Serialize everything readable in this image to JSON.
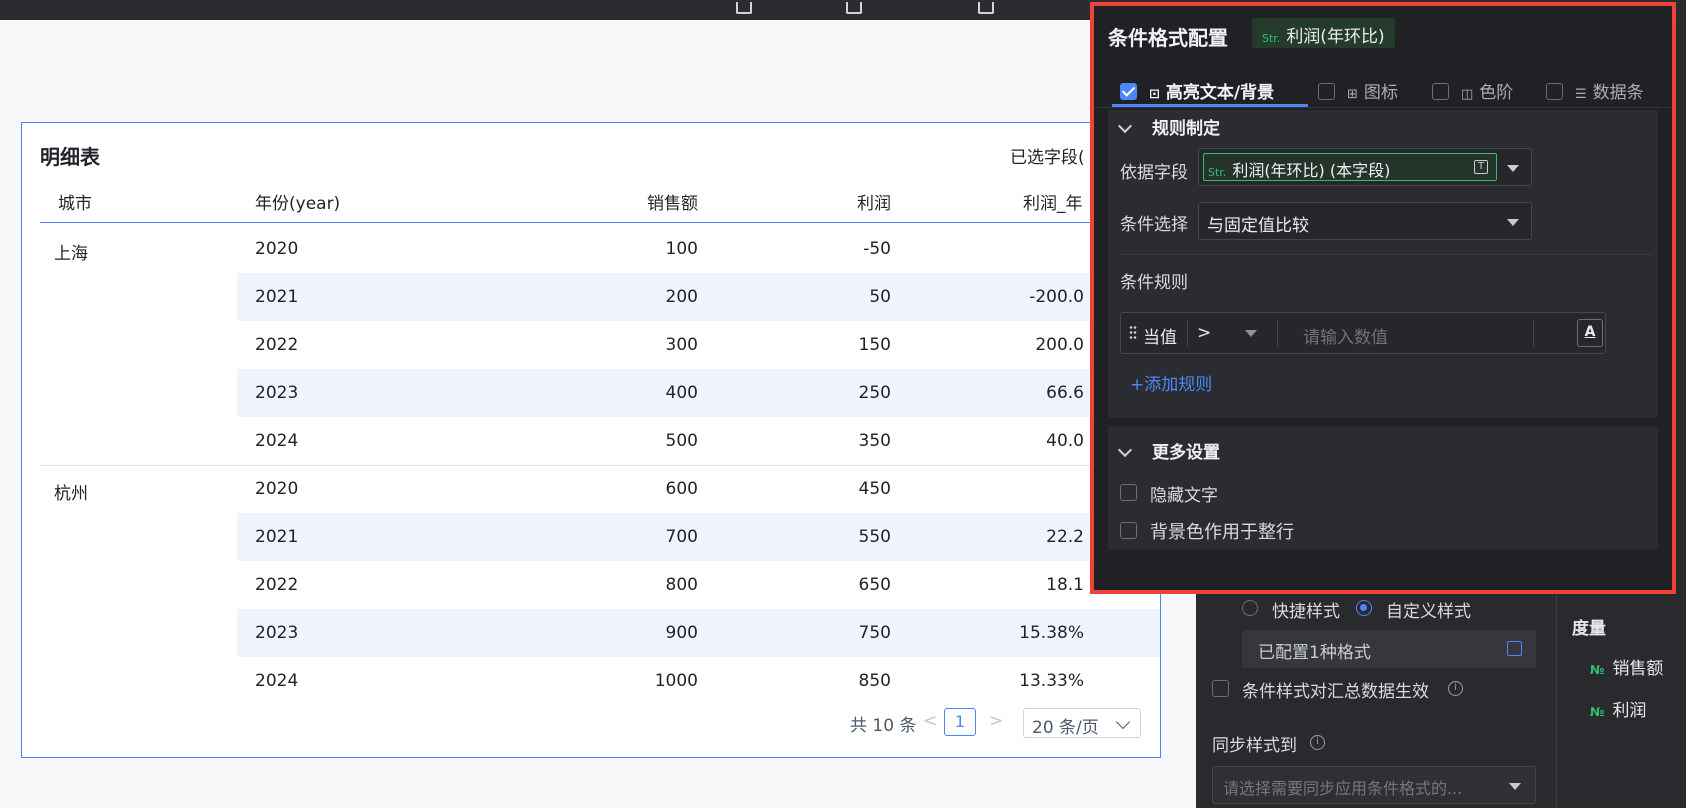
{
  "table": {
    "title": "明细表",
    "selected_fields": "已选字段(",
    "headers": [
      "城市",
      "年份(year)",
      "销售额",
      "利润",
      "利润_年"
    ],
    "groups": [
      {
        "city": "上海",
        "rows": [
          {
            "year": "2020",
            "sales": "100",
            "profit": "-50",
            "yoy": ""
          },
          {
            "year": "2021",
            "sales": "200",
            "profit": "50",
            "yoy": "-200.0"
          },
          {
            "year": "2022",
            "sales": "300",
            "profit": "150",
            "yoy": "200.0"
          },
          {
            "year": "2023",
            "sales": "400",
            "profit": "250",
            "yoy": "66.6"
          },
          {
            "year": "2024",
            "sales": "500",
            "profit": "350",
            "yoy": "40.0"
          }
        ]
      },
      {
        "city": "杭州",
        "rows": [
          {
            "year": "2020",
            "sales": "600",
            "profit": "450",
            "yoy": ""
          },
          {
            "year": "2021",
            "sales": "700",
            "profit": "550",
            "yoy": "22.2"
          },
          {
            "year": "2022",
            "sales": "800",
            "profit": "650",
            "yoy": "18.1"
          },
          {
            "year": "2023",
            "sales": "900",
            "profit": "750",
            "yoy": "15.38%"
          },
          {
            "year": "2024",
            "sales": "1000",
            "profit": "850",
            "yoy": "13.33%"
          }
        ]
      }
    ],
    "pagination": {
      "total": "共 10 条",
      "prev": "<",
      "page": "1",
      "next": ">",
      "page_size": "20 条/页"
    }
  },
  "side_panel": {
    "quick_style": "快捷样式",
    "custom_style": "自定义样式",
    "configured": "已配置1种格式",
    "apply_summary": "条件样式对汇总数据生效",
    "sync_to": "同步样式到",
    "sync_placeholder": "请选择需要同步应用条件格式的...",
    "measure_title": "度量",
    "measures": [
      {
        "type": "№",
        "label": "销售额"
      },
      {
        "type": "№",
        "label": "利润"
      }
    ]
  },
  "popup": {
    "title": "条件格式配置",
    "field_tag_type": "Str.",
    "field_tag": "利润(年环比)",
    "tabs": [
      {
        "label": "高亮文本/背景",
        "checked": true,
        "icon": "text-box-icon"
      },
      {
        "label": "图标",
        "checked": false,
        "icon": "grid-icon"
      },
      {
        "label": "色阶",
        "checked": false,
        "icon": "color-scale-icon"
      },
      {
        "label": "数据条",
        "checked": false,
        "icon": "data-bar-icon"
      }
    ],
    "rule_section": {
      "title": "规则制定",
      "basis_label": "依据字段",
      "basis_type": "Str.",
      "basis_value": "利润(年环比) (本字段)",
      "condition_label": "条件选择",
      "condition_value": "与固定值比较",
      "rules_label": "条件规则",
      "rule_when": "当值",
      "rule_operator": ">",
      "rule_placeholder": "请输入数值",
      "font_button": "A",
      "add_rule": "+添加规则"
    },
    "more_section": {
      "title": "更多设置",
      "hide_text": "隐藏文字",
      "bg_whole_row": "背景色作用于整行"
    }
  },
  "colors": {
    "accent": "#4d86f7",
    "highlight_border": "#ef4137",
    "str_green": "#2fbf71"
  }
}
